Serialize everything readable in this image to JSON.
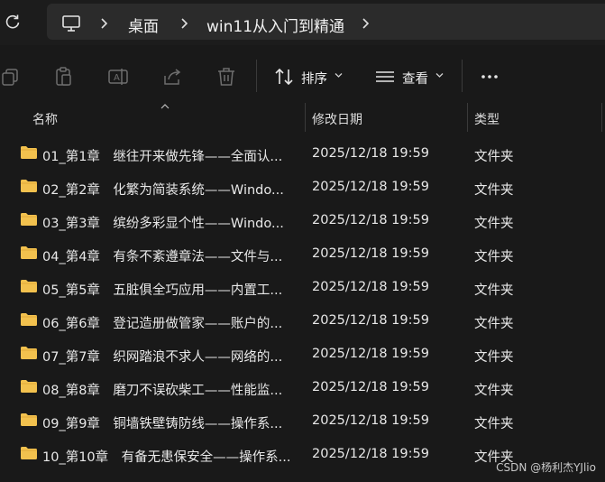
{
  "address": {
    "refresh_icon": "refresh-icon",
    "crumbs": [
      "桌面",
      "win11从入门到精通"
    ],
    "pc_icon": "monitor-icon"
  },
  "toolbar": {
    "sort_label": "排序",
    "view_label": "查看",
    "more_label": "···"
  },
  "columns": {
    "name": "名称",
    "date": "修改日期",
    "type": "类型"
  },
  "rows": [
    {
      "name": "01_第1章　继往开来做先锋——全面认...",
      "date": "2025/12/18 19:59",
      "type": "文件夹"
    },
    {
      "name": "02_第2章　化繁为简装系统——Windo...",
      "date": "2025/12/18 19:59",
      "type": "文件夹"
    },
    {
      "name": "03_第3章　缤纷多彩显个性——Windo...",
      "date": "2025/12/18 19:59",
      "type": "文件夹"
    },
    {
      "name": "04_第4章　有条不紊遵章法——文件与...",
      "date": "2025/12/18 19:59",
      "type": "文件夹"
    },
    {
      "name": "05_第5章　五脏俱全巧应用——内置工...",
      "date": "2025/12/18 19:59",
      "type": "文件夹"
    },
    {
      "name": "06_第6章　登记造册做管家——账户的...",
      "date": "2025/12/18 19:59",
      "type": "文件夹"
    },
    {
      "name": "07_第7章　织网踏浪不求人——网络的...",
      "date": "2025/12/18 19:59",
      "type": "文件夹"
    },
    {
      "name": "08_第8章　磨刀不误砍柴工——性能监...",
      "date": "2025/12/18 19:59",
      "type": "文件夹"
    },
    {
      "name": "09_第9章　铜墙铁壁铸防线——操作系...",
      "date": "2025/12/18 19:59",
      "type": "文件夹"
    },
    {
      "name": "10_第10章　有备无患保安全——操作系...",
      "date": "2025/12/18 19:59",
      "type": "文件夹"
    }
  ],
  "watermark": "CSDN @杨利杰YJlio",
  "colors": {
    "background": "#191919",
    "address_bar": "#2b2b2b",
    "folder": "#f2c14e"
  }
}
